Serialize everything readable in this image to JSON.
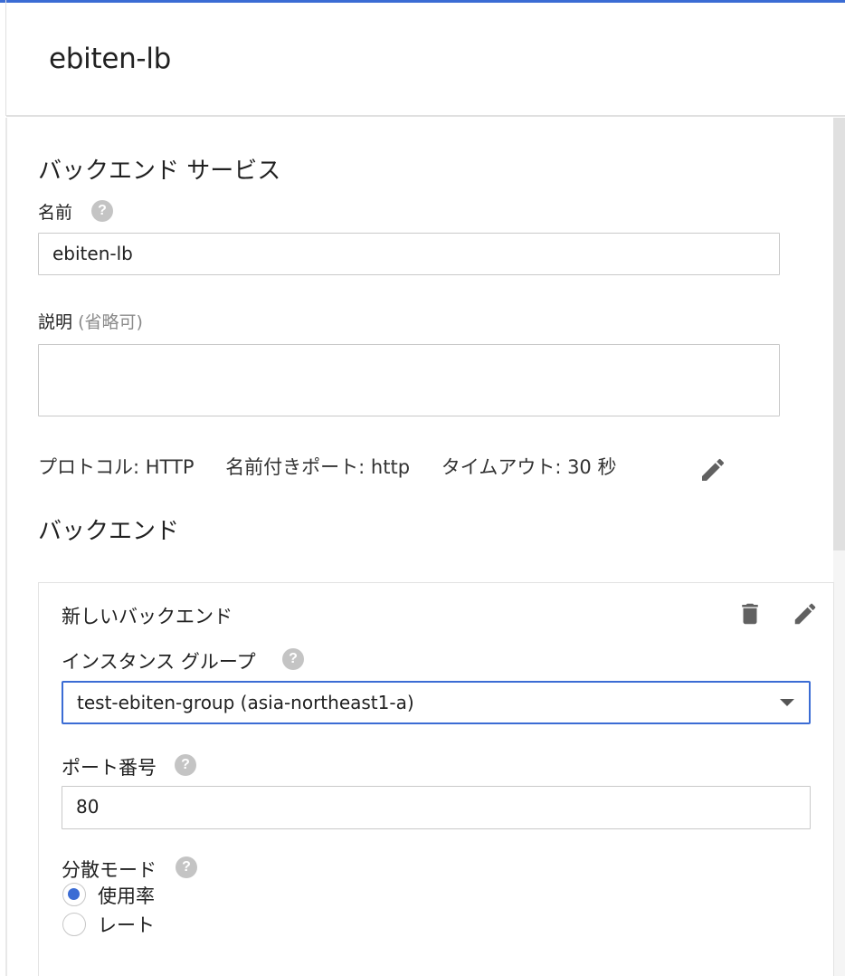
{
  "header": {
    "title": "ebiten-lb"
  },
  "backend_service": {
    "section_title": "バックエンド サービス",
    "name_label": "名前",
    "name_value": "ebiten-lb",
    "description_label": "説明",
    "description_optional": "(省略可)",
    "description_value": "",
    "protocol": "プロトコル: HTTP",
    "named_port": "名前付きポート: http",
    "timeout": "タイムアウト: 30 秒"
  },
  "backends": {
    "section_title": "バックエンド",
    "card": {
      "title": "新しいバックエンド",
      "instance_group_label": "インスタンス グループ",
      "instance_group_value": "test-ebiten-group (asia-northeast1-a)",
      "port_label": "ポート番号",
      "port_value": "80",
      "balancing_mode_label": "分散モード",
      "balancing_modes": [
        {
          "label": "使用率",
          "checked": true
        },
        {
          "label": "レート",
          "checked": false
        }
      ]
    }
  },
  "help_glyph": "?",
  "icons": [
    "help-icon",
    "edit-icon",
    "delete-icon",
    "dropdown-caret-icon",
    "resize-grip-icon"
  ],
  "colors": {
    "accent": "#3b6cd4",
    "help_icon": "#c4c4c4",
    "icon_grey": "#616161",
    "border": "#c9c9c9"
  }
}
